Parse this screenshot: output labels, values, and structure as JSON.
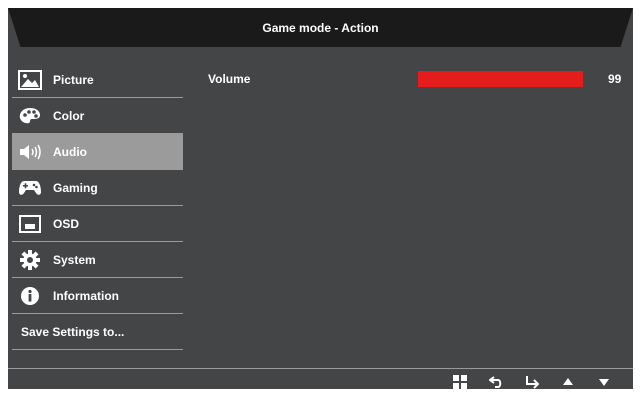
{
  "title": "Game mode - Action",
  "menu": [
    {
      "label": "Picture",
      "icon": "picture-icon"
    },
    {
      "label": "Color",
      "icon": "palette-icon"
    },
    {
      "label": "Audio",
      "icon": "speaker-icon",
      "active": true
    },
    {
      "label": "Gaming",
      "icon": "gamepad-icon"
    },
    {
      "label": "OSD",
      "icon": "osd-icon"
    },
    {
      "label": "System",
      "icon": "gear-icon"
    },
    {
      "label": "Information",
      "icon": "info-icon"
    },
    {
      "label": "Save Settings to..."
    }
  ],
  "audio": {
    "volume_label": "Volume",
    "volume_value": "99",
    "volume_fraction": 0.99
  },
  "nav_icons": [
    "menu-grid-icon",
    "back-icon",
    "enter-icon",
    "up-arrow-icon",
    "down-arrow-icon"
  ],
  "colors": {
    "accent": "#e31c1c",
    "background": "#444547",
    "titlebar": "#1a1a1a",
    "active_item": "#9b9b9b"
  }
}
